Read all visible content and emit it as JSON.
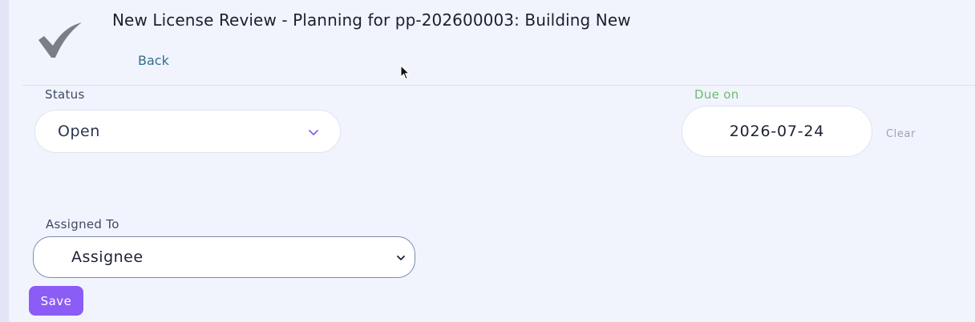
{
  "header": {
    "title": "New License Review - Planning for pp-202600003: Building New",
    "back_label": "Back",
    "status_icon": "check-icon"
  },
  "form": {
    "status": {
      "label": "Status",
      "value": "Open"
    },
    "due": {
      "label": "Due on",
      "value": "2026-07-24",
      "clear_label": "Clear"
    },
    "assigned": {
      "label": "Assigned To",
      "value": "Assignee"
    },
    "save_label": "Save"
  },
  "colors": {
    "accent": "#8b5cf6",
    "due_label": "#6dbb6d",
    "link": "#2f6f8f",
    "background": "#f1f4fd"
  }
}
